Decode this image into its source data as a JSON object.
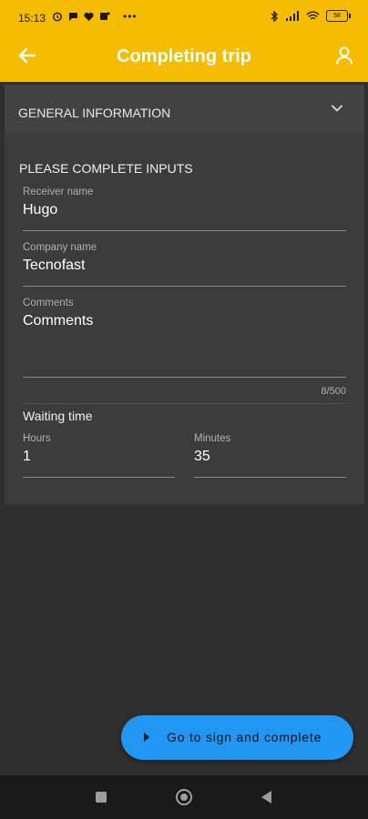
{
  "status_bar": {
    "time": "15:13",
    "battery": "58",
    "icons": [
      "alarm-icon",
      "chat-bubble-icon",
      "heart-icon",
      "teams-icon",
      "more-icon",
      "bluetooth-icon",
      "signal-icon",
      "wifi-icon",
      "battery-icon"
    ]
  },
  "app_bar": {
    "title": "Completing trip",
    "back_icon": "arrow-left-icon",
    "profile_icon": "person-icon"
  },
  "general_section": {
    "label": "GENERAL INFORMATION",
    "icon": "chevron-down-icon"
  },
  "form": {
    "title": "PLEASE COMPLETE INPUTS",
    "receiver": {
      "label": "Receiver name",
      "value": "Hugo"
    },
    "company": {
      "label": "Company name",
      "value": "Tecnofast"
    },
    "comments": {
      "label": "Comments",
      "value": "Comments",
      "counter": "8/500"
    },
    "waiting_time": {
      "title": "Waiting time",
      "hours": {
        "label": "Hours",
        "value": "1"
      },
      "minutes": {
        "label": "Minutes",
        "value": "35"
      }
    }
  },
  "fab": {
    "label": "Go to sign and complete",
    "color": "#2196f3"
  },
  "colors": {
    "accent": "#f5bc00",
    "background": "#2f2f2f",
    "card": "#3c3c3c"
  }
}
